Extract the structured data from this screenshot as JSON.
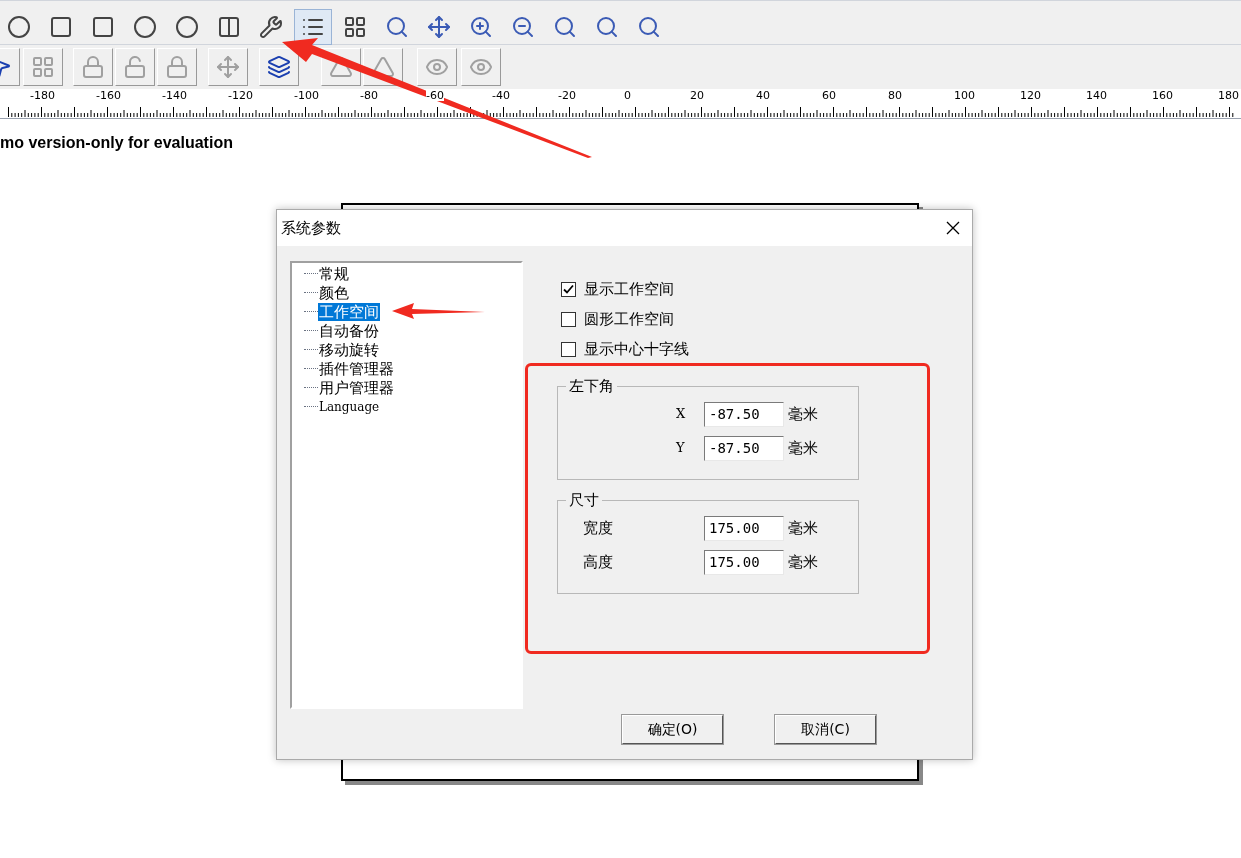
{
  "toolbar": {
    "row_1": [
      {
        "pressed": false
      },
      {
        "pressed": false
      },
      {
        "pressed": false
      },
      {
        "pressed": false
      },
      {
        "pressed": false
      },
      {
        "pressed": false
      },
      {
        "pressed": false
      },
      {
        "pressed": true
      },
      {
        "pressed": false
      },
      {
        "pressed": false
      },
      {
        "pressed": false
      },
      {
        "pressed": false
      },
      {
        "pressed": false
      },
      {
        "pressed": false
      },
      {
        "pressed": false
      },
      {
        "pressed": false
      }
    ],
    "row_2": [
      {
        "disabled": false
      },
      {
        "disabled": true
      },
      {
        "disabled": true
      },
      {
        "disabled": true
      },
      {
        "disabled": true
      },
      {
        "disabled": true
      },
      {
        "disabled": false
      },
      {
        "disabled": true
      },
      {
        "disabled": true
      },
      {
        "disabled": true
      },
      {
        "disabled": true
      }
    ]
  },
  "ruler": {
    "labels": [
      "-180",
      "-160",
      "-140",
      "-120",
      "-100",
      "-80",
      "-60",
      "-40",
      "-20",
      "0",
      "20",
      "40",
      "60",
      "80",
      "100",
      "120",
      "140",
      "160",
      "180"
    ]
  },
  "notice": "mo version-only for evaluation",
  "dialog": {
    "title": "系统参数",
    "tree": [
      {
        "label": "常规",
        "selected": false
      },
      {
        "label": "颜色",
        "selected": false
      },
      {
        "label": "工作空间",
        "selected": true
      },
      {
        "label": "自动备份",
        "selected": false
      },
      {
        "label": "移动旋转",
        "selected": false
      },
      {
        "label": "插件管理器",
        "selected": false
      },
      {
        "label": "用户管理器",
        "selected": false
      },
      {
        "label": "Language",
        "selected": false
      }
    ],
    "checkboxes": [
      {
        "label": "显示工作空间",
        "checked": true
      },
      {
        "label": "圆形工作空间",
        "checked": false
      },
      {
        "label": "显示中心十字线",
        "checked": false
      }
    ],
    "groups": [
      {
        "title": "左下角",
        "fields": [
          {
            "label": "X",
            "value": "-87.50",
            "unit": "毫米"
          },
          {
            "label": "Y",
            "value": "-87.50",
            "unit": "毫米"
          }
        ]
      },
      {
        "title": "尺寸",
        "fields": [
          {
            "label": "宽度",
            "value": "175.00",
            "unit": "毫米"
          },
          {
            "label": "高度",
            "value": "175.00",
            "unit": "毫米"
          }
        ]
      }
    ],
    "buttons": [
      "确定(O)",
      "取消(C)"
    ]
  }
}
